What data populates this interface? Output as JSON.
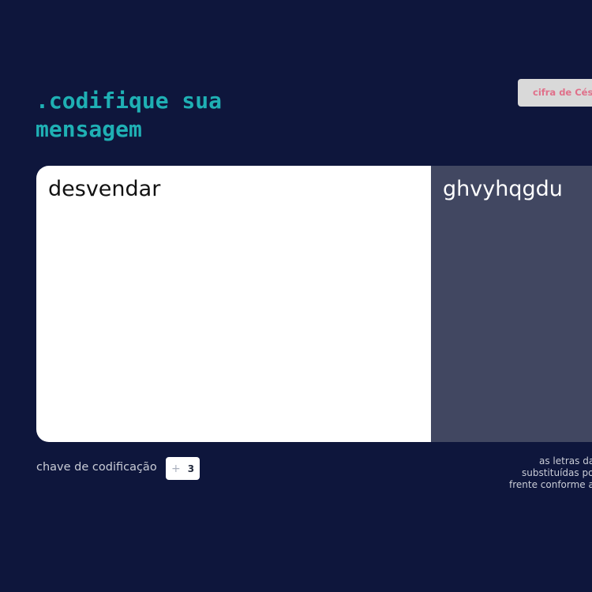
{
  "header": {
    "title_line1": ".codifique sua",
    "title_line2": "mensagem",
    "method_button_label": "cifra de César"
  },
  "editor": {
    "input_text": "desvendar",
    "output_text": "ghvyhqgdu"
  },
  "key": {
    "label": "chave de codificação",
    "plus_symbol": "+",
    "value": "3"
  },
  "note": {
    "line1": "as letras da",
    "line2": "substituídas por",
    "line3": "frente conforme a"
  },
  "colors": {
    "background": "#0e163c",
    "title": "#1fb0b4",
    "output_panel": "#414761",
    "button_text": "#e0708a"
  }
}
